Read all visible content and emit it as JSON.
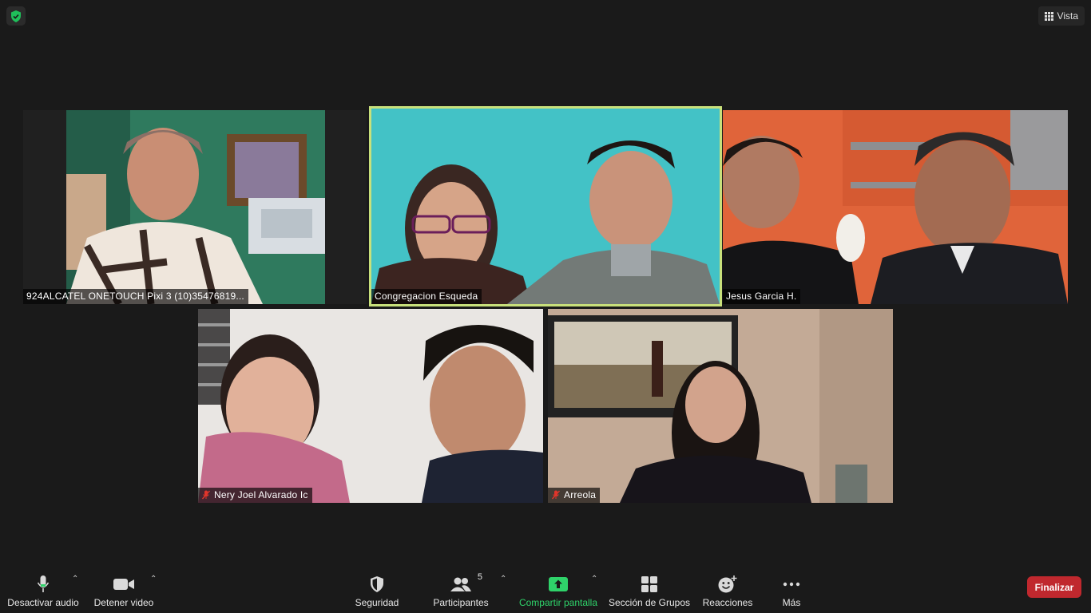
{
  "top": {
    "view_label": "Vista"
  },
  "participants": [
    {
      "name": "924ALCATEL ONETOUCH Pixi 3 (10)35476819...",
      "muted": false,
      "active": false
    },
    {
      "name": "Congregacion Esqueda",
      "muted": false,
      "active": true
    },
    {
      "name": "Jesus Garcia H.",
      "muted": false,
      "active": false
    },
    {
      "name": "Nery Joel Alvarado Ic",
      "muted": true,
      "active": false
    },
    {
      "name": "Arreola",
      "muted": true,
      "active": false
    }
  ],
  "toolbar": {
    "audio_label": "Desactivar audio",
    "video_label": "Detener video",
    "security_label": "Seguridad",
    "participants_label": "Participantes",
    "participants_count": "5",
    "share_label": "Compartir pantalla",
    "breakout_label": "Sección de Grupos",
    "reactions_label": "Reacciones",
    "more_label": "Más",
    "end_label": "Finalizar"
  },
  "colors": {
    "active_border": "#c8e07b",
    "end_button": "#c0282e",
    "share_green": "#2fd36a",
    "security_green": "#1fbf5a"
  }
}
